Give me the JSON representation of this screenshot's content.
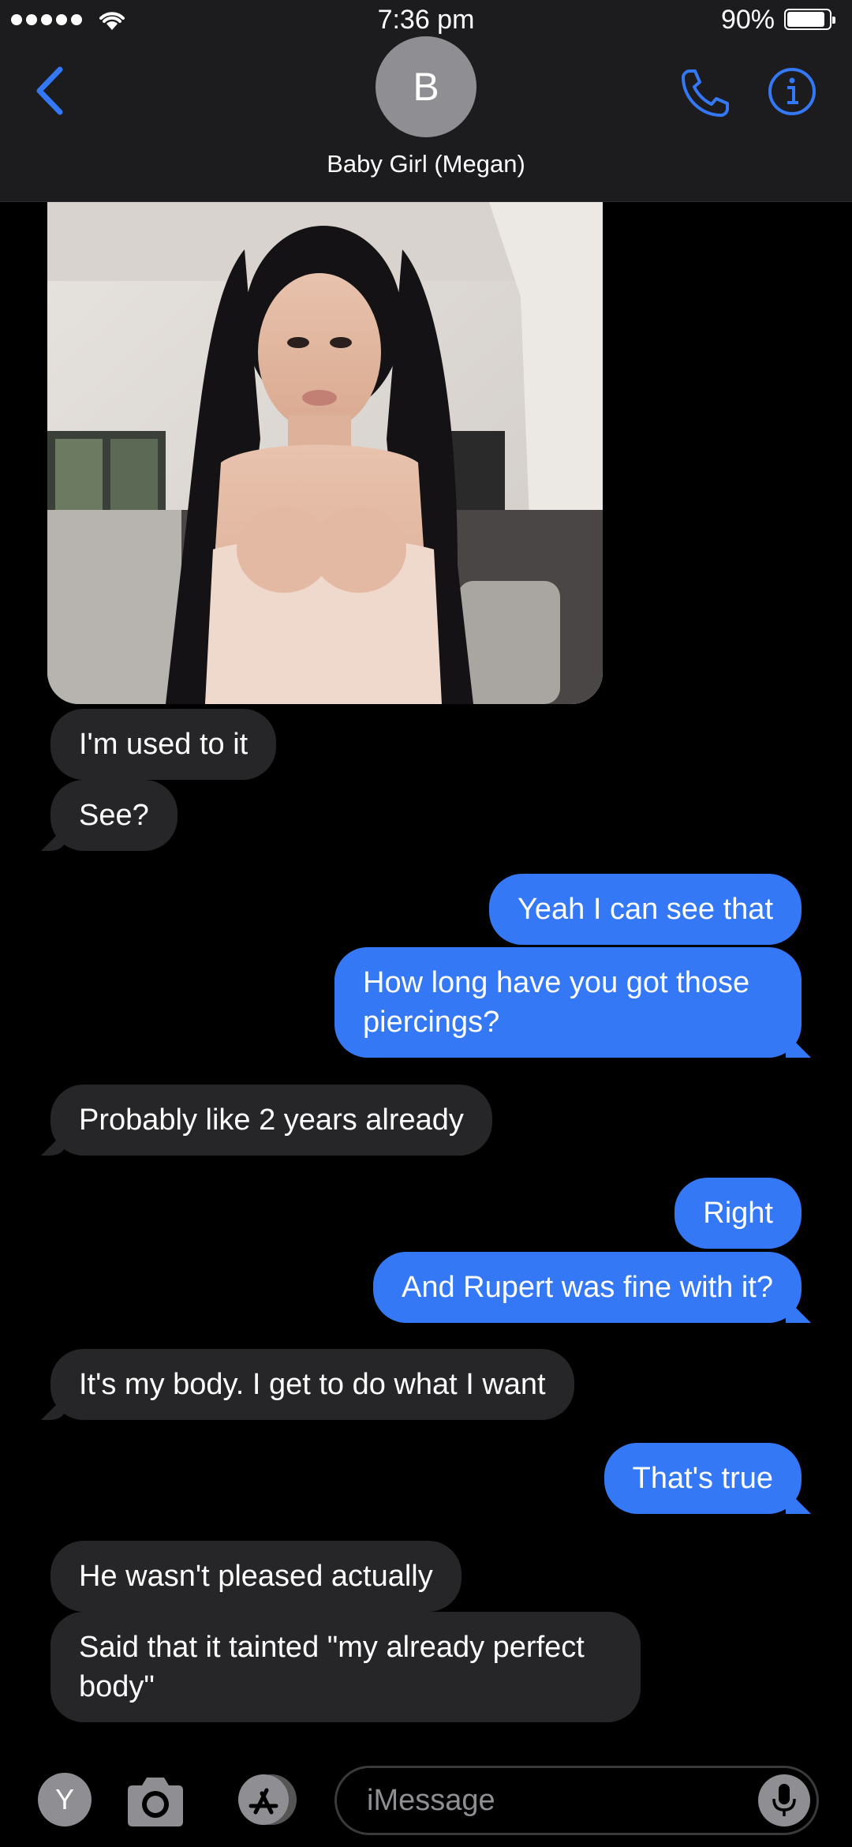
{
  "status_bar": {
    "time": "7:36 pm",
    "battery_percent": "90%",
    "battery_level": 0.9,
    "signal_bars": 5
  },
  "header": {
    "avatar_initial": "B",
    "contact_name": "Baby Girl (Megan)"
  },
  "messages": [
    {
      "direction": "incoming",
      "type": "image",
      "alt": "photo"
    },
    {
      "direction": "incoming",
      "text": "I'm used to it"
    },
    {
      "direction": "incoming",
      "text": "See?"
    },
    {
      "direction": "outgoing",
      "text": "Yeah I can see that"
    },
    {
      "direction": "outgoing",
      "text": "How long have you got those piercings?"
    },
    {
      "direction": "incoming",
      "text": "Probably like 2 years already"
    },
    {
      "direction": "outgoing",
      "text": "Right"
    },
    {
      "direction": "outgoing",
      "text": "And Rupert was fine with it?"
    },
    {
      "direction": "incoming",
      "text": "It's my body. I get to do what I want"
    },
    {
      "direction": "outgoing",
      "text": "That's true"
    },
    {
      "direction": "incoming",
      "text": "He wasn't pleased actually"
    },
    {
      "direction": "incoming",
      "text": "Said that it tainted \"my already perfect body\""
    }
  ],
  "input_bar": {
    "app_icon_letter": "Y",
    "placeholder": "iMessage"
  },
  "colors": {
    "outgoing_bubble": "#3478f6",
    "incoming_bubble": "#262628",
    "accent": "#3478f6",
    "header_bg": "#1c1c1e"
  },
  "icons": [
    "back-chevron-icon",
    "phone-icon",
    "info-icon",
    "camera-icon",
    "app-store-icon",
    "microphone-icon"
  ]
}
